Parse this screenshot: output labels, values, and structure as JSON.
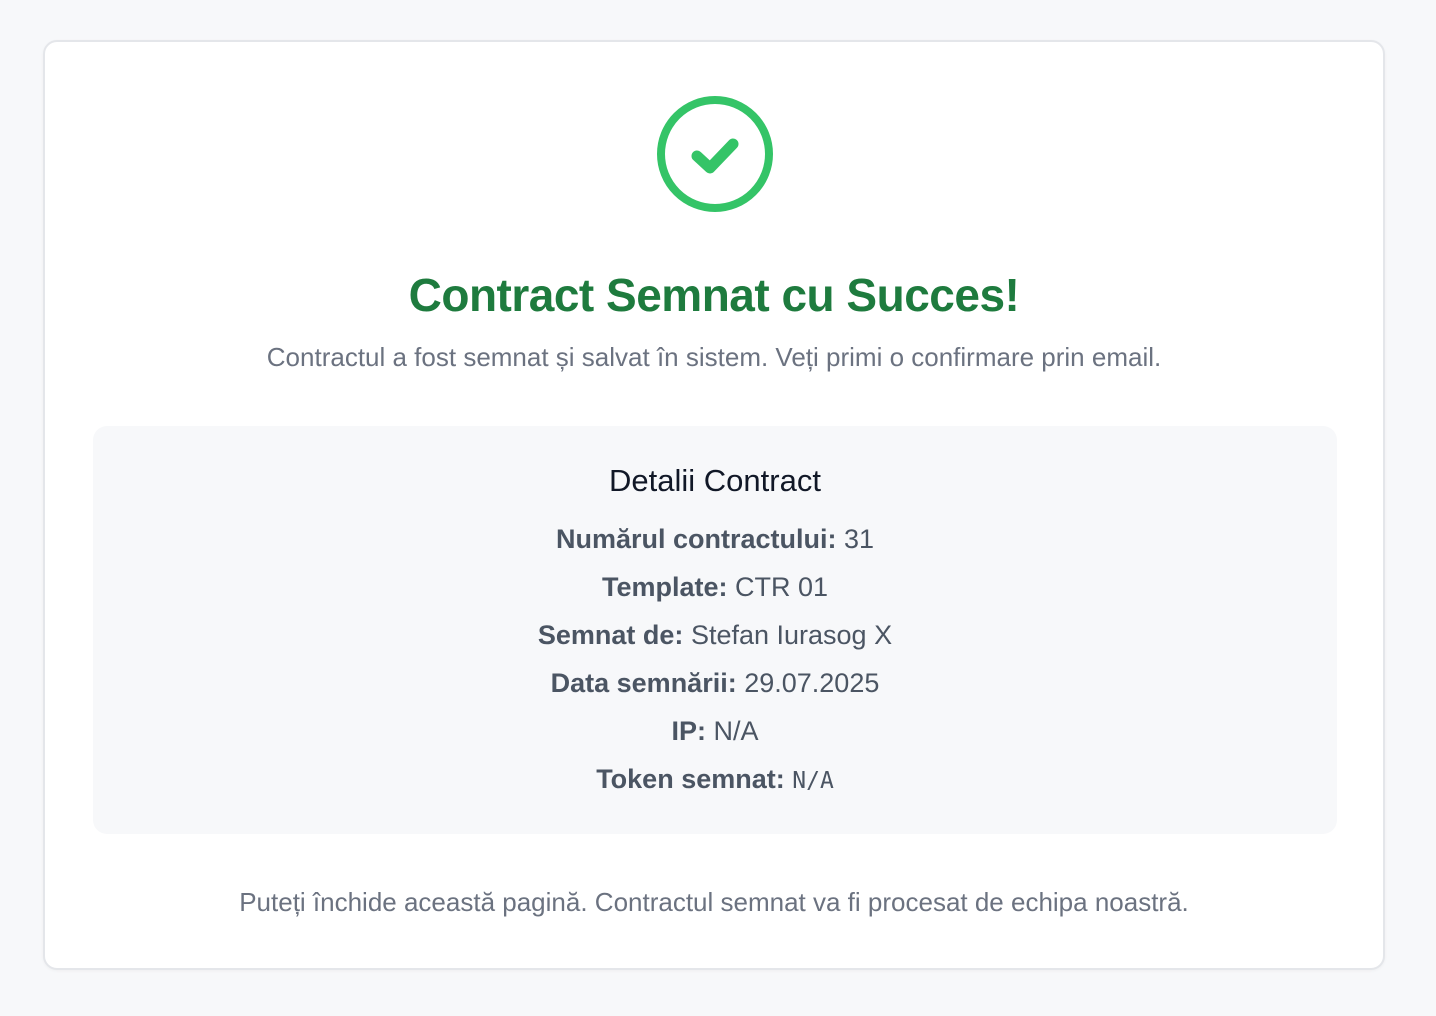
{
  "colors": {
    "background": "#f7f8fa",
    "card": "#ffffff",
    "success_green": "#34c467",
    "title_green": "#1e7b3e",
    "muted_text": "#6b7280",
    "label_text": "#4b5563"
  },
  "status_icon": "check-circle-icon",
  "title": "Contract Semnat cu Succes!",
  "subtitle": "Contractul a fost semnat și salvat în sistem. Veți primi o confirmare prin email.",
  "details": {
    "heading": "Detalii Contract",
    "rows": [
      {
        "label": "Numărul contractului:",
        "value": "31"
      },
      {
        "label": "Template:",
        "value": "CTR 01"
      },
      {
        "label": "Semnat de:",
        "value": "Stefan Iurasog X"
      },
      {
        "label": "Data semnării:",
        "value": "29.07.2025"
      },
      {
        "label": "IP:",
        "value": "N/A"
      },
      {
        "label": "Token semnat:",
        "value": "N/A"
      }
    ]
  },
  "footer_note": "Puteți închide această pagină. Contractul semnat va fi procesat de echipa noastră."
}
